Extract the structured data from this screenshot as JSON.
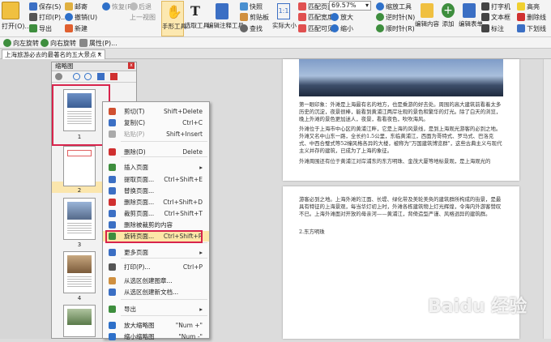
{
  "toolbar": {
    "open": "打开(O)...",
    "save": "保存(S)",
    "print": "打印(P)...",
    "export": "导出",
    "email": "邮寄",
    "undo": "撤销(U)",
    "redo": "恢复(R)",
    "new": "新建",
    "back": "后退",
    "prev_view": "上一视图",
    "hand_tool": "手形工具",
    "select_text": "选取工具",
    "edit_comment": "编辑注释工具",
    "snapshot": "快照",
    "clipboard": "剪贴板",
    "find": "查找",
    "actual_size": "实际大小",
    "fit_page": "匹配页面",
    "zoom_value": "69.57%",
    "fit_width": "匹配宽度",
    "zoom_in": "放大",
    "fit_visible": "匹配可见",
    "zoom_out": "缩小",
    "zoom_tool": "缩放工具",
    "rotate_left": "逆时针(N)",
    "rotate_right": "顺时针(R)",
    "edit_content": "编辑内容",
    "add": "添加",
    "edit_form": "编辑表单",
    "typewriter": "打字机",
    "textbox": "文本框",
    "mark": "标注",
    "highlight": "高亮",
    "strikeout": "删除线",
    "underline": "下划线",
    "rotate_left_view": "向左旋转",
    "rotate_right_view": "向右旋转",
    "properties": "属性(P)..."
  },
  "tab": {
    "title": "上海旅游必去的最著名的五大景点 *",
    "close": "×"
  },
  "panel": {
    "title": "缩略图",
    "close": "x",
    "pages": [
      "1",
      "2",
      "3",
      "4"
    ]
  },
  "context_menu": {
    "items": [
      {
        "label": "剪切(T)",
        "shortcut": "Shift+Delete",
        "icon": "scissors-icon"
      },
      {
        "label": "复制(C)",
        "shortcut": "Ctrl+C",
        "icon": "copy-icon"
      },
      {
        "label": "粘贴(P)",
        "shortcut": "Shift+Insert",
        "icon": "paste-icon"
      },
      {
        "label": "删除(D)",
        "shortcut": "Delete",
        "icon": "delete-icon"
      },
      {
        "label": "插入页面",
        "shortcut": "",
        "icon": "insert-page-icon"
      },
      {
        "label": "提取页面...",
        "shortcut": "Ctrl+Shift+E",
        "icon": "extract-page-icon"
      },
      {
        "label": "替换页面...",
        "shortcut": "",
        "icon": "replace-page-icon"
      },
      {
        "label": "删除页面...",
        "shortcut": "Ctrl+Shift+D",
        "icon": "delete-page-icon"
      },
      {
        "label": "裁剪页面...",
        "shortcut": "Ctrl+Shift+T",
        "icon": "crop-page-icon"
      },
      {
        "label": "删除被裁剪的内容",
        "shortcut": "",
        "icon": "remove-cropped-icon"
      },
      {
        "label": "旋转页面...",
        "shortcut": "Ctrl+Shift+R",
        "icon": "rotate-page-icon"
      },
      {
        "label": "更多页面",
        "shortcut": "",
        "icon": "more-pages-icon"
      },
      {
        "label": "打印(P)...",
        "shortcut": "Ctrl+P",
        "icon": "print-icon"
      },
      {
        "label": "从选区创建图章...",
        "shortcut": "",
        "icon": "stamp-icon"
      },
      {
        "label": "从选区创建新文档...",
        "shortcut": "",
        "icon": "new-doc-icon"
      },
      {
        "label": "导出",
        "shortcut": "",
        "icon": "export-icon"
      },
      {
        "label": "放大缩略图",
        "shortcut": "\"Num +\"",
        "icon": "enlarge-thumb-icon"
      },
      {
        "label": "缩小缩略图",
        "shortcut": "\"Num -\"",
        "icon": "shrink-thumb-icon"
      }
    ]
  },
  "document": {
    "para1": "第一眼印象：外滩是上海最有名的地方，也是乘游的好去处。周围的高大建筑前看着太多历史的沉淀，夜景很棒，能看到黄浦江两岸壮观的景色和繁华的灯光。除了白天的浏览，晚上外滩的景色更加迷人，夜景，看看夜色，吹吹海风。",
    "para2": "外滩位于上海市中心区的黄浦江畔，它是上海的风景线，是到上海观光游客的必到之地。外滩又名中山东一路，全长约1.5公里，东临黄浦江，西面为哥特式、罗马式、巴洛克式、中西合璧式等52幢风格各异的大楼，被称为\"万国建筑博览群\"，这些古典主义与现代主义并存的建筑，已成为了上海的象征。",
    "para3": "外滩周围还有位于黄浦江对岸浦东的东方明珠、金茂大厦等地标景观，是上海观光的",
    "para4": "游客必到之地。上海外滩的江面、长堤、绿化带及美轮美奂的建筑群所构成的街景，是最具有特征的上海景观，每当华灯初上时，外滩各栋建筑物上灯光辉煌，令海内外游客赞叹不已。上海外滩面对开放的母亲河——黄浦江，背倚造型严谨、风格迥异的建筑群。",
    "heading2": "2.东方明珠"
  },
  "watermark": "Baidu 经验",
  "colors": {
    "highlight": "#d8244c",
    "selected_item": "#fde7a8",
    "panel_selected": "#fbe6ad"
  }
}
